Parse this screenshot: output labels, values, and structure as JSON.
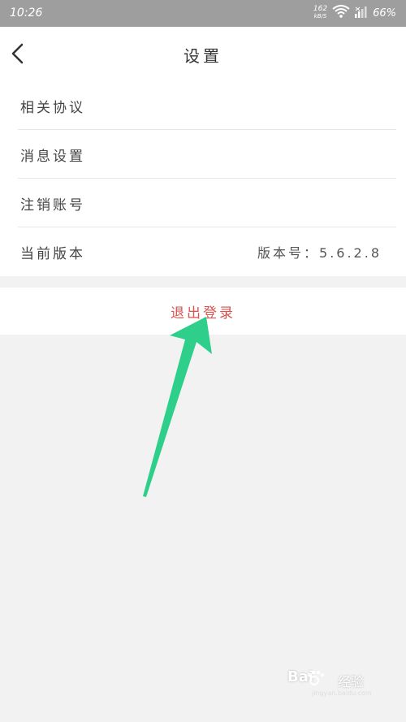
{
  "status_bar": {
    "time": "10:26",
    "net_speed": "162",
    "net_unit": "kB/S",
    "battery": "66%",
    "icons": [
      "wifi-icon",
      "signal-icon",
      "battery-icon"
    ]
  },
  "nav": {
    "back_icon": "chevron-left-icon",
    "title": "设置"
  },
  "menu": {
    "items": [
      {
        "label": "相关协议",
        "value": ""
      },
      {
        "label": "消息设置",
        "value": ""
      },
      {
        "label": "注销账号",
        "value": ""
      },
      {
        "label": "当前版本",
        "value": "版本号：5.6.2.8"
      }
    ]
  },
  "logout": {
    "label": "退出登录",
    "color": "#d9534f"
  },
  "annotation": {
    "arrow_color": "#2ecf8a"
  },
  "watermark": {
    "logo": "Bai",
    "logo_suffix": "经验",
    "url": "jingyan.baidu.com"
  }
}
